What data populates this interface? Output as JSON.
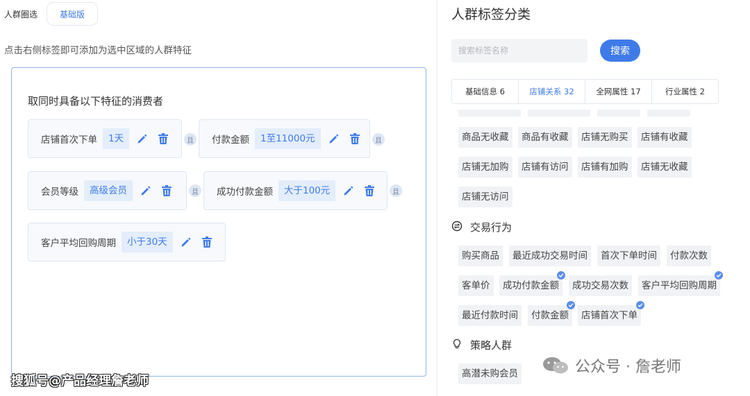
{
  "left": {
    "crowd_filter_label": "人群圈选",
    "basic_button": "基础版",
    "hint": "点击右侧标签即可添加为选中区域的人群特征",
    "box_title": "取同时具备以下特征的消费者",
    "conditions": [
      {
        "label": "店铺首次下单",
        "value": "1天"
      },
      {
        "label": "付款金额",
        "value": "1至11000元"
      },
      {
        "label": "会员等级",
        "value": "高级会员"
      },
      {
        "label": "成功付款金额",
        "value": "大于100元"
      },
      {
        "label": "客户平均回购周期",
        "value": "小于30天"
      }
    ],
    "and_label": "且",
    "watermark": "搜狐号@产品经理詹老师"
  },
  "right": {
    "title": "人群标签分类",
    "search": {
      "placeholder": "搜索标签名称",
      "button": "搜索"
    },
    "tabs": [
      {
        "label": "基础信息 6"
      },
      {
        "label": "店铺关系 32"
      },
      {
        "label": "全网属性 17"
      },
      {
        "label": "行业属性 2"
      }
    ],
    "store_tags": [
      "商品无收藏",
      "商品有收藏",
      "店铺无购买",
      "店铺有收藏",
      "店铺无加购",
      "店铺有访问",
      "店铺有加购",
      "店铺无收藏",
      "店铺无访问"
    ],
    "trade_section": {
      "title": "交易行为",
      "icon": "exchange-icon",
      "tags": [
        "购买商品",
        "最近成功交易时间",
        "首次下单时间",
        "付款次数",
        "客单价",
        "成功付款金额",
        "成功交易次数",
        "客户平均回购周期",
        "最近付款时间",
        "付款金额",
        "店铺首次下单"
      ]
    },
    "strategy_section": {
      "title": "策略人群",
      "icon": "lightbulb-icon",
      "tags": [
        "高潜未购会员"
      ]
    },
    "watermark": "公众号 · 詹老师"
  },
  "colors": {
    "accent": "#3f7be8",
    "tag_bg": "#f0f2f5",
    "value_bg": "#e3edfb"
  }
}
